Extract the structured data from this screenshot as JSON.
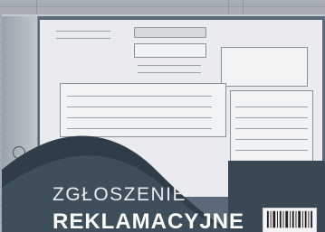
{
  "cover": {
    "title_line1": "ZGŁOSZENIE",
    "title_line2": "REKLAMACYJNE"
  }
}
